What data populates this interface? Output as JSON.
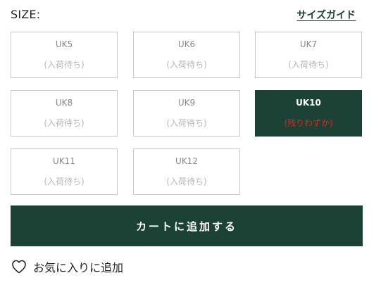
{
  "size_section": {
    "label": "SIZE:",
    "guide_link": "サイズガイド"
  },
  "sizes": [
    {
      "name": "UK5",
      "stock": "(入荷待ち)",
      "selected": false
    },
    {
      "name": "UK6",
      "stock": "(入荷待ち)",
      "selected": false
    },
    {
      "name": "UK7",
      "stock": "(入荷待ち)",
      "selected": false
    },
    {
      "name": "UK8",
      "stock": "(入荷待ち)",
      "selected": false
    },
    {
      "name": "UK9",
      "stock": "(入荷待ち)",
      "selected": false
    },
    {
      "name": "UK10",
      "stock": "(残りわずか)",
      "selected": true
    },
    {
      "name": "UK11",
      "stock": "(入荷待ち)",
      "selected": false
    },
    {
      "name": "UK12",
      "stock": "(入荷待ち)",
      "selected": false
    }
  ],
  "cart": {
    "add_label": "カートに追加する"
  },
  "favorite": {
    "label": "お気に入りに追加",
    "icon": "heart-outline-icon"
  },
  "colors": {
    "brand_green": "#1b4234",
    "low_stock_red": "#e02424",
    "border_gray": "#c8c8c8",
    "muted_text": "#b8b8b8"
  }
}
